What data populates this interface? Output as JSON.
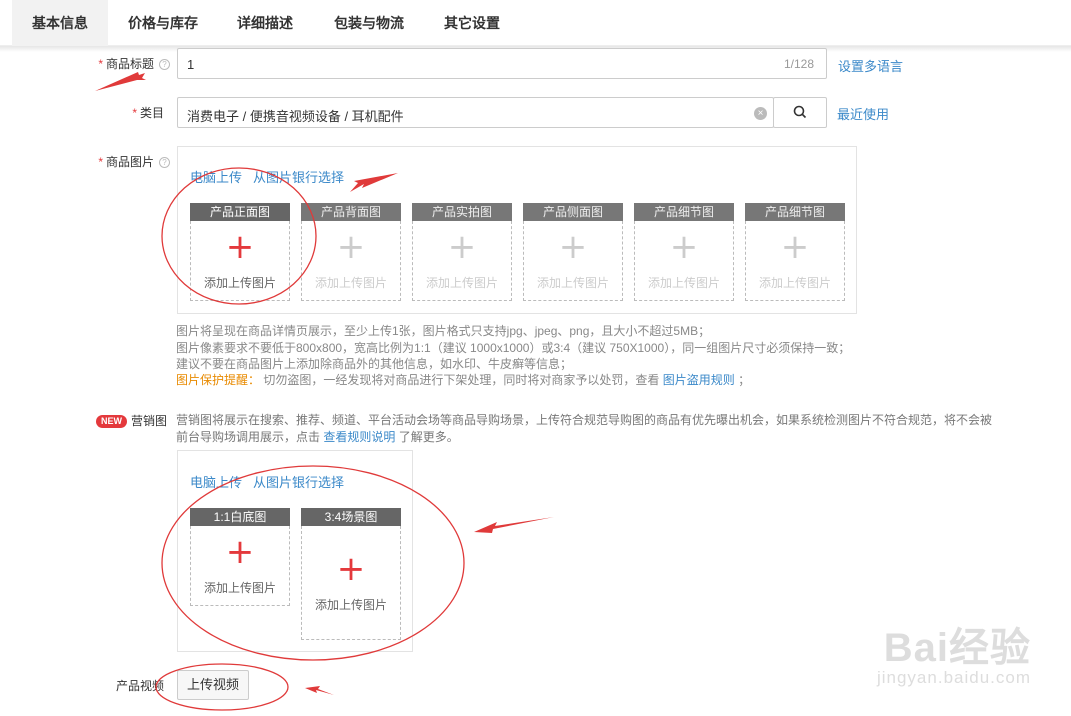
{
  "tabs": [
    {
      "label": "基本信息",
      "active": true
    },
    {
      "label": "价格与库存",
      "active": false
    },
    {
      "label": "详细描述",
      "active": false
    },
    {
      "label": "包装与物流",
      "active": false
    },
    {
      "label": "其它设置",
      "active": false
    }
  ],
  "title_field": {
    "required_mark": "*",
    "label": "商品标题",
    "value": "1",
    "counter": "1/128",
    "multilang_link": "设置多语言"
  },
  "category_field": {
    "required_mark": "*",
    "label": "类目",
    "value": "消费电子 / 便携音视频设备 / 耳机配件",
    "recent_link": "最近使用"
  },
  "product_images": {
    "required_mark": "*",
    "label": "商品图片",
    "upload_pc": "电脑上传",
    "from_bank": "从图片银行选择",
    "slots": [
      {
        "title": "产品正面图",
        "add_text": "添加上传图片"
      },
      {
        "title": "产品背面图",
        "add_text": "添加上传图片"
      },
      {
        "title": "产品实拍图",
        "add_text": "添加上传图片"
      },
      {
        "title": "产品侧面图",
        "add_text": "添加上传图片"
      },
      {
        "title": "产品细节图",
        "add_text": "添加上传图片"
      },
      {
        "title": "产品细节图",
        "add_text": "添加上传图片"
      }
    ],
    "notes": {
      "line1": "图片将呈现在商品详情页展示，至少上传1张，图片格式只支持jpg、jpeg、png，且大小不超过5MB；",
      "line2": "图片像素要求不要低于800x800，宽高比例为1:1（建议 1000x1000）或3:4（建议 750X1000），同一组图片尺寸必须保持一致；",
      "line3": "建议不要在商品图片上添加除商品外的其他信息，如水印、牛皮癣等信息；",
      "warn_label": "图片保护提醒：",
      "warn_text": "切勿盗图，一经发现将对商品进行下架处理，同时将对商家予以处罚，查看",
      "rule_link": "图片盗用规则",
      "tail": "；"
    }
  },
  "marketing_images": {
    "badge": "NEW",
    "label": "营销图",
    "desc_line1": "营销图将展示在搜索、推荐、频道、平台活动会场等商品导购场景，上传符合规范导购图的商品有优先曝出机会，如果系统检测图片不符合规范，将不会被",
    "desc_line2_a": "前台导购场调用展示，点击",
    "desc_link": "查看规则说明",
    "desc_line2_b": "了解更多。",
    "upload_pc": "电脑上传",
    "from_bank": "从图片银行选择",
    "slots": [
      {
        "title": "1:1白底图",
        "add_text": "添加上传图片"
      },
      {
        "title": "3:4场景图",
        "add_text": "添加上传图片"
      }
    ]
  },
  "video": {
    "label": "产品视频",
    "button": "上传视频"
  },
  "watermark": {
    "brand": "Bai经验",
    "url": "jingyan.baidu.com"
  },
  "colors": {
    "accent_link": "#3b89c9",
    "required": "#e4393c",
    "annotation": "#e03a3a"
  }
}
